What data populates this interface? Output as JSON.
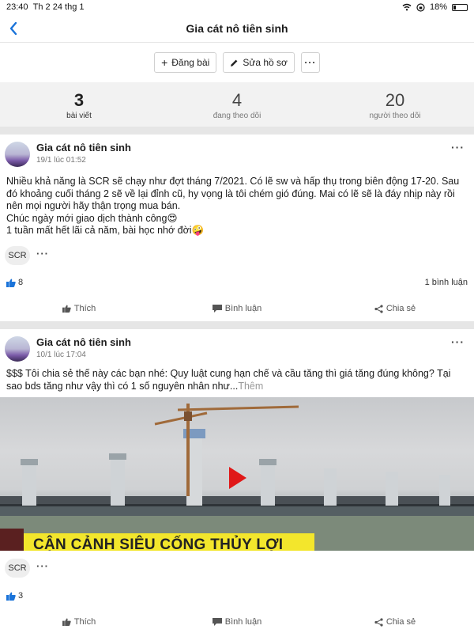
{
  "status": {
    "time": "23:40",
    "date": "Th 2 24 thg 1",
    "battery": "18%"
  },
  "nav": {
    "title": "Gia cát nô tiên sinh"
  },
  "actions": {
    "post_label": "Đăng bài",
    "edit_label": "Sửa hồ sơ"
  },
  "stats": [
    {
      "value": "3",
      "label": "bài viết"
    },
    {
      "value": "4",
      "label": "đang theo dõi"
    },
    {
      "value": "20",
      "label": "người theo dõi"
    }
  ],
  "posts": [
    {
      "author": "Gia cát nô tiên sinh",
      "time": "19/1 lúc 01:52",
      "lines": [
        "Nhiều khả năng là SCR sẽ chạy như đợt tháng 7/2021. Có lẽ sw và hấp thụ trong biên động 17-20. Sau đó khoảng cuối tháng 2 sẽ về lại đỉnh cũ, hy vọng là tôi chém gió đúng. Mai có lẽ sẽ là đáy nhịp này rồi nên mọi người hãy thận trọng mua bán.",
        "Chúc ngày mới giao dịch thành công😍",
        "1 tuần mất hết lãi cả năm, bài học nhớ đời🤪"
      ],
      "tag": "SCR",
      "likes": "8",
      "comments": "1 bình luận"
    },
    {
      "author": "Gia cát nô tiên sinh",
      "time": "10/1 lúc 17:04",
      "text": " $$$ Tôi chia sẻ thế này các bạn nhé: Quy luật cung hạn chế và cầu tăng thì giá tăng đúng không? Tại sao bds tăng như vậy thì có 1 số nguyên nhân như...",
      "more": "Thêm",
      "video_caption": "CẬN CẢNH SIÊU CỐNG THỦY LỢI",
      "tag": "SCR",
      "likes": "3"
    }
  ],
  "post_actions": {
    "like": "Thích",
    "comment": "Bình luận",
    "share": "Chia sẻ"
  },
  "colors": {
    "accent": "#1a73d9",
    "like_blue": "#1a73d9",
    "play_red": "#e01818",
    "banner_yellow": "#f3e62c"
  }
}
